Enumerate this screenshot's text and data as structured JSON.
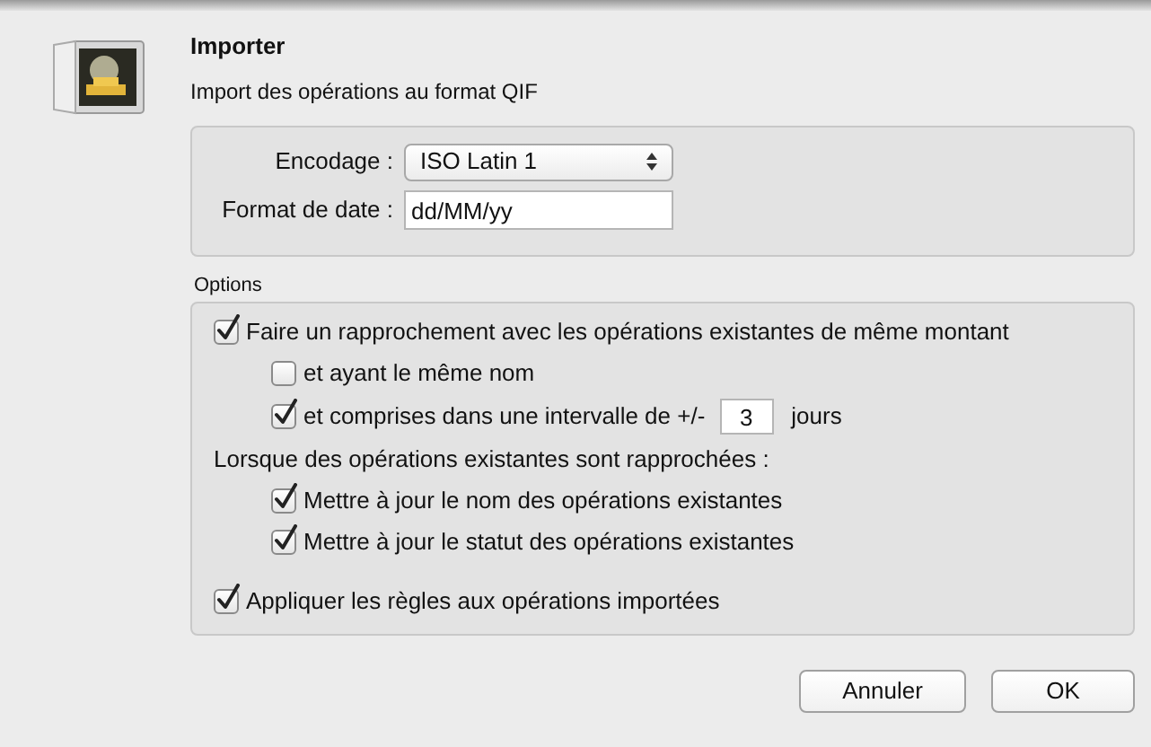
{
  "dialog": {
    "title": "Importer",
    "subtitle": "Import des opérations au format QIF"
  },
  "format": {
    "encoding": {
      "label": "Encodage :",
      "value": "ISO Latin 1"
    },
    "date_format": {
      "label": "Format de date :",
      "value": "dd/MM/yy"
    }
  },
  "options": {
    "title": "Options",
    "items": [
      {
        "kind": "checkbox",
        "label": "Faire un rapprochement avec les opérations existantes de même montant",
        "checked": true,
        "children": [
          {
            "kind": "checkbox",
            "label": "et ayant le même nom",
            "checked": false
          },
          {
            "kind": "range",
            "label": "et comprises dans une intervalle de +/-",
            "value": "3",
            "unit": "jours",
            "checked": true
          }
        ]
      },
      {
        "kind": "heading",
        "label": "Lorsque des opérations existantes sont rapprochées :",
        "children": [
          {
            "kind": "checkbox",
            "label": "Mettre à jour le nom des opérations existantes",
            "checked": true
          },
          {
            "kind": "checkbox",
            "label": "Mettre à jour le statut des opérations existantes",
            "checked": true
          }
        ]
      },
      {
        "kind": "checkbox",
        "label": "Appliquer les règles aux opérations importées",
        "checked": true
      }
    ]
  },
  "buttons": [
    {
      "label": "Annuler",
      "kind": "cancel"
    },
    {
      "label": "OK",
      "kind": "default"
    }
  ]
}
